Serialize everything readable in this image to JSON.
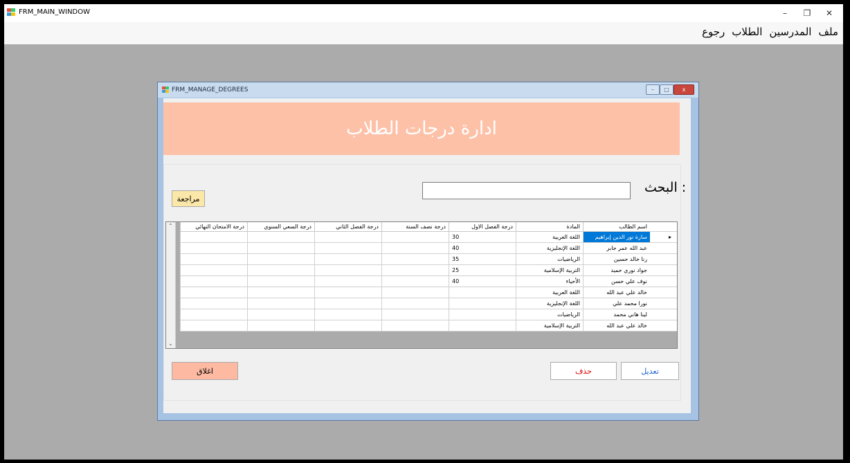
{
  "main_window": {
    "title": "FRM_MAIN_WINDOW",
    "controls": {
      "minimize": "–",
      "restore": "❐",
      "close": "✕"
    },
    "menu": [
      "ملف",
      "المدرسين",
      "الطلاب",
      "رجوع"
    ]
  },
  "child_window": {
    "title": "FRM_MANAGE_DEGREES",
    "controls": {
      "minimize": "–",
      "restore": "□",
      "close": "x"
    }
  },
  "banner": {
    "title": "ادارة درجات الطلاب",
    "color": "#fdc1a8"
  },
  "search": {
    "label": "البحث :",
    "value": ""
  },
  "buttons": {
    "review": "مراجعة",
    "close": "اغلاق",
    "delete": "حذف",
    "edit": "تعديل"
  },
  "grid": {
    "columns": [
      "اسم الطالب",
      "المادة",
      "درجة الفصل الاول",
      "درجة نصف السنة",
      "درجة الفصل الثاني",
      "درجة السعي السنوي",
      "درجة الامتحان النهائي"
    ],
    "rows": [
      [
        "سارة نور الدين إبراهيم",
        "اللغة العربية",
        "30",
        "",
        "",
        "",
        ""
      ],
      [
        "عبد الله عمر جابر",
        "اللغة الإنجليزية",
        "40",
        "",
        "",
        "",
        ""
      ],
      [
        "رنا خالد حسين",
        "الرياضيات",
        "35",
        "",
        "",
        "",
        ""
      ],
      [
        "جواد نوري حميد",
        "التربية الإسلامية",
        "25",
        "",
        "",
        "",
        ""
      ],
      [
        "نوف علي حسن",
        "الأحياء",
        "40",
        "",
        "",
        "",
        ""
      ],
      [
        "خالد علي عبد الله",
        "اللغة العربية",
        "",
        "",
        "",
        "",
        ""
      ],
      [
        "نورا محمد علي",
        "اللغة الإنجليزية",
        "",
        "",
        "",
        "",
        ""
      ],
      [
        "لينا هاني محمد",
        "الرياضيات",
        "",
        "",
        "",
        "",
        ""
      ],
      [
        "خالد علي عبد الله",
        "التربية الإسلامية",
        "",
        "",
        "",
        "",
        ""
      ]
    ],
    "selected_row": 0,
    "current_row_marker": "▸",
    "scroll_up": "⌃",
    "scroll_down": "⌄"
  },
  "colors": {
    "accent": "#fdc1a8",
    "review_button": "#fbe7a8",
    "close_button": "#fdb9a1",
    "selection": "#0078d7",
    "delete_text": "#e00000",
    "edit_text": "#1a5fcf"
  }
}
